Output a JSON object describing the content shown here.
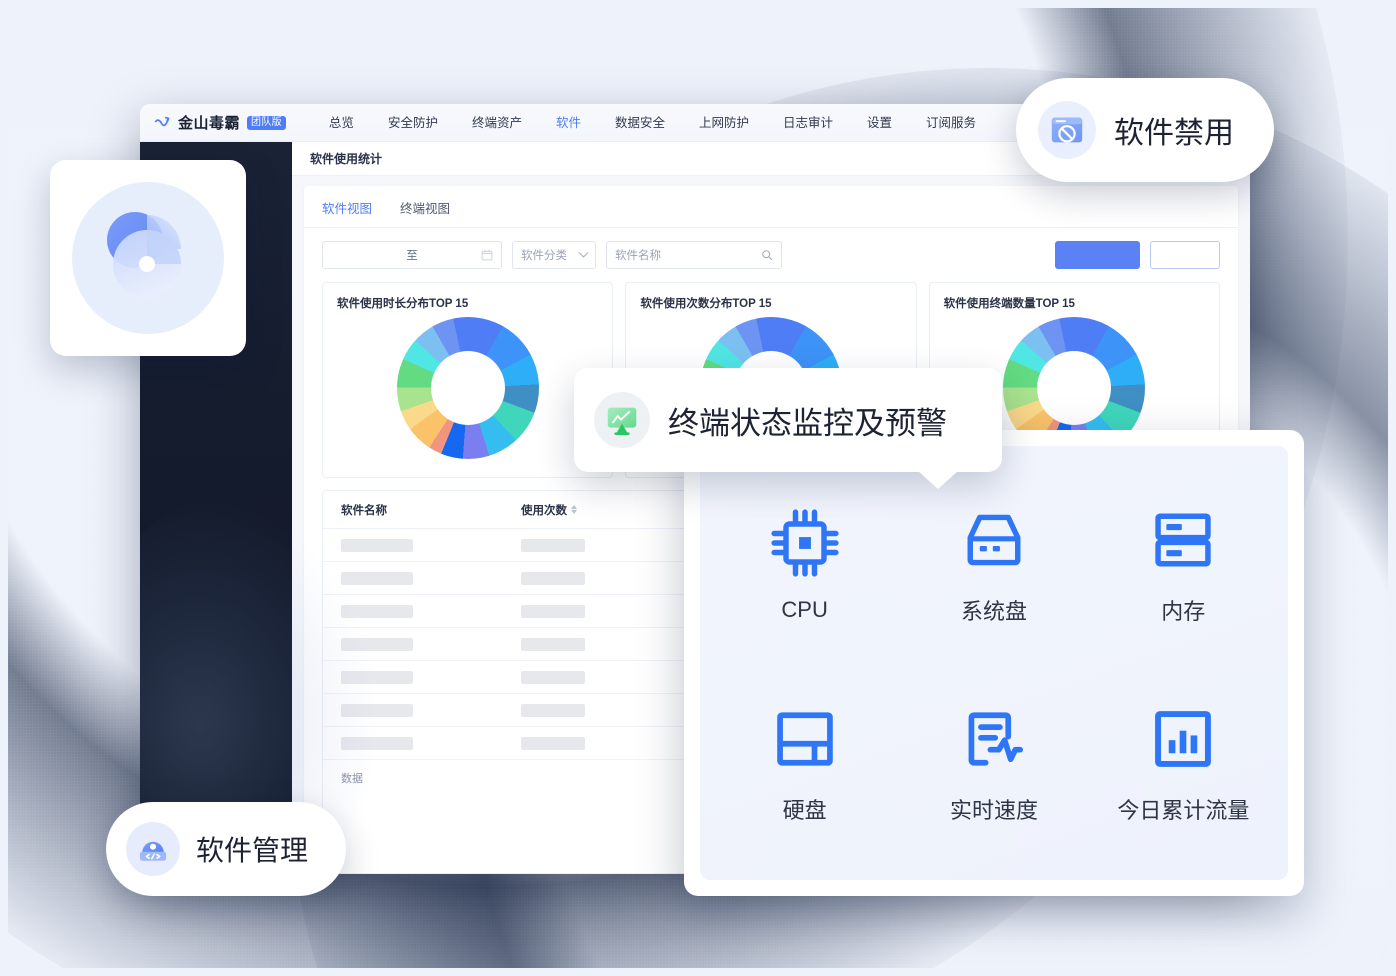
{
  "theme": {
    "accent": "#4f7df6",
    "accent_fill": "#5b82f5",
    "backdrop_blue": "#2b63cd",
    "backdrop_navy": "#101f3c",
    "sidebar_dark": "#141b2c",
    "text_dark": "#1d2333"
  },
  "app": {
    "logo_text": "金山毒霸",
    "logo_badge": "团队版",
    "logo_icon": "swoosh-check-icon",
    "nav": [
      {
        "label": "总览",
        "active": false
      },
      {
        "label": "安全防护",
        "active": false
      },
      {
        "label": "终端资产",
        "active": false
      },
      {
        "label": "软件",
        "active": true
      },
      {
        "label": "数据安全",
        "active": false
      },
      {
        "label": "上网防护",
        "active": false
      },
      {
        "label": "日志审计",
        "active": false
      },
      {
        "label": "设置",
        "active": false
      },
      {
        "label": "订阅服务",
        "active": false
      }
    ],
    "breadcrumb": "软件使用统计",
    "view_tabs": [
      {
        "label": "软件视图",
        "active": true
      },
      {
        "label": "终端视图",
        "active": false
      }
    ],
    "filters": {
      "date_range_separator": "至",
      "date_range_value": "",
      "calendar_icon": "calendar-icon",
      "category_placeholder": "软件分类",
      "category_value": "软件分类",
      "chevron_icon": "chevron-down-icon",
      "name_placeholder": "软件名称",
      "name_value": "",
      "search_icon": "search-icon",
      "primary_button_label": "",
      "ghost_button_label": ""
    },
    "charts": [
      {
        "title": "软件使用时长分布TOP 15",
        "type": "donut",
        "segments": [
          {
            "color": "#4f7df6",
            "percent": 11.5
          },
          {
            "color": "#3d93f8",
            "percent": 9.0
          },
          {
            "color": "#2eaef7",
            "percent": 7.0
          },
          {
            "color": "#3f8fc4",
            "percent": 6.5
          },
          {
            "color": "#3fd6bb",
            "percent": 7.5
          },
          {
            "color": "#35bdf0",
            "percent": 7.0
          },
          {
            "color": "#7b7ef0",
            "percent": 6.0
          },
          {
            "color": "#1668f0",
            "percent": 5.0
          },
          {
            "color": "#f1957e",
            "percent": 3.0
          },
          {
            "color": "#fac36a",
            "percent": 6.0
          },
          {
            "color": "#fbd98a",
            "percent": 4.5
          },
          {
            "color": "#a9e38d",
            "percent": 5.5
          },
          {
            "color": "#63db82",
            "percent": 6.5
          },
          {
            "color": "#4fe6e4",
            "percent": 5.0
          },
          {
            "color": "#7cc0f2",
            "percent": 5.0
          },
          {
            "color": "#6d94f2",
            "percent": 5.0
          }
        ]
      },
      {
        "title": "软件使用次数分布TOP 15",
        "type": "donut",
        "segments": [
          {
            "color": "#4f7df6",
            "percent": 11.5
          },
          {
            "color": "#3d93f8",
            "percent": 9.0
          },
          {
            "color": "#2eaef7",
            "percent": 7.0
          },
          {
            "color": "#3f8fc4",
            "percent": 6.5
          },
          {
            "color": "#3fd6bb",
            "percent": 7.5
          },
          {
            "color": "#35bdf0",
            "percent": 7.0
          },
          {
            "color": "#7b7ef0",
            "percent": 6.0
          },
          {
            "color": "#1668f0",
            "percent": 5.0
          },
          {
            "color": "#f1957e",
            "percent": 3.0
          },
          {
            "color": "#fac36a",
            "percent": 6.0
          },
          {
            "color": "#fbd98a",
            "percent": 4.5
          },
          {
            "color": "#a9e38d",
            "percent": 5.5
          },
          {
            "color": "#63db82",
            "percent": 6.5
          },
          {
            "color": "#4fe6e4",
            "percent": 5.0
          },
          {
            "color": "#7cc0f2",
            "percent": 5.0
          },
          {
            "color": "#6d94f2",
            "percent": 5.0
          }
        ]
      },
      {
        "title": "软件使用终端数量TOP 15",
        "type": "donut",
        "segments": [
          {
            "color": "#4f7df6",
            "percent": 11.5
          },
          {
            "color": "#3d93f8",
            "percent": 9.0
          },
          {
            "color": "#2eaef7",
            "percent": 7.0
          },
          {
            "color": "#3f8fc4",
            "percent": 6.5
          },
          {
            "color": "#3fd6bb",
            "percent": 7.5
          },
          {
            "color": "#35bdf0",
            "percent": 7.0
          },
          {
            "color": "#7b7ef0",
            "percent": 6.0
          },
          {
            "color": "#1668f0",
            "percent": 5.0
          },
          {
            "color": "#f1957e",
            "percent": 3.0
          },
          {
            "color": "#fac36a",
            "percent": 6.0
          },
          {
            "color": "#fbd98a",
            "percent": 4.5
          },
          {
            "color": "#a9e38d",
            "percent": 5.5
          },
          {
            "color": "#63db82",
            "percent": 6.5
          },
          {
            "color": "#4fe6e4",
            "percent": 5.0
          },
          {
            "color": "#7cc0f2",
            "percent": 5.0
          },
          {
            "color": "#6d94f2",
            "percent": 5.0
          }
        ]
      }
    ],
    "table": {
      "columns": [
        {
          "label": "软件名称",
          "sortable": false
        },
        {
          "label": "使用次数",
          "sortable": true,
          "sort_icon": "sort-arrows-icon"
        },
        {
          "label": "",
          "sortable": false
        },
        {
          "label": "",
          "sortable": false
        }
      ],
      "skeleton_rows": 7,
      "footer_text": "数据"
    }
  },
  "chips": {
    "software_disable": {
      "label": "软件禁用",
      "icon": "window-blocked-icon"
    },
    "software_manage": {
      "label": "软件管理",
      "icon": "code-package-icon"
    }
  },
  "callout": {
    "label": "终端状态监控及预警",
    "icon": "monitor-chart-icon"
  },
  "pie_card": {
    "icon": "pie-chart-overlap-icon"
  },
  "monitor_panel": {
    "metrics": [
      {
        "label": "CPU",
        "icon": "cpu-chip-icon"
      },
      {
        "label": "系统盘",
        "icon": "system-drive-icon"
      },
      {
        "label": "内存",
        "icon": "memory-rack-icon"
      },
      {
        "label": "硬盘",
        "icon": "hard-disk-icon"
      },
      {
        "label": "实时速度",
        "icon": "realtime-speed-icon"
      },
      {
        "label": "今日累计流量",
        "icon": "traffic-bar-chart-icon"
      }
    ]
  }
}
